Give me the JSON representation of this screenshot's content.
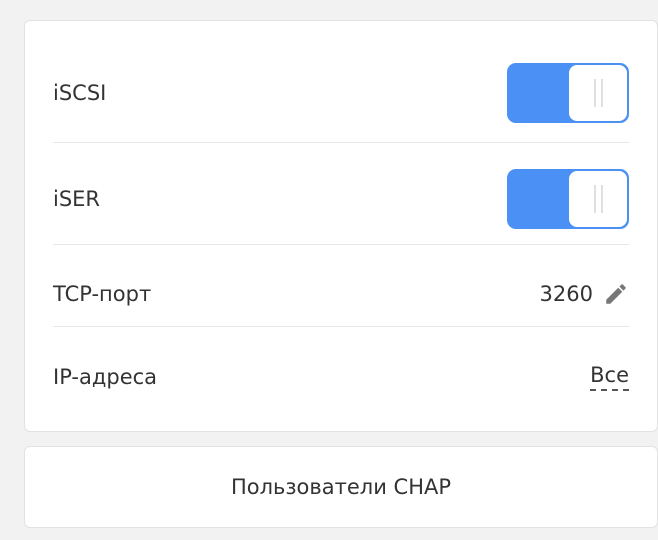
{
  "settings": {
    "rows": [
      {
        "label": "iSCSI",
        "type": "toggle",
        "enabled": true
      },
      {
        "label": "iSER",
        "type": "toggle",
        "enabled": true
      },
      {
        "label": "TCP-порт",
        "type": "editable",
        "value": "3260",
        "icon": "pencil-icon"
      },
      {
        "label": "IP-адреса",
        "type": "link",
        "value": "Все"
      }
    ]
  },
  "chap_button": {
    "label": "Пользователи CHAP"
  },
  "colors": {
    "accent": "#4a90f5",
    "text": "#333333",
    "border": "#e2e2e2",
    "background": "#f2f2f2"
  }
}
